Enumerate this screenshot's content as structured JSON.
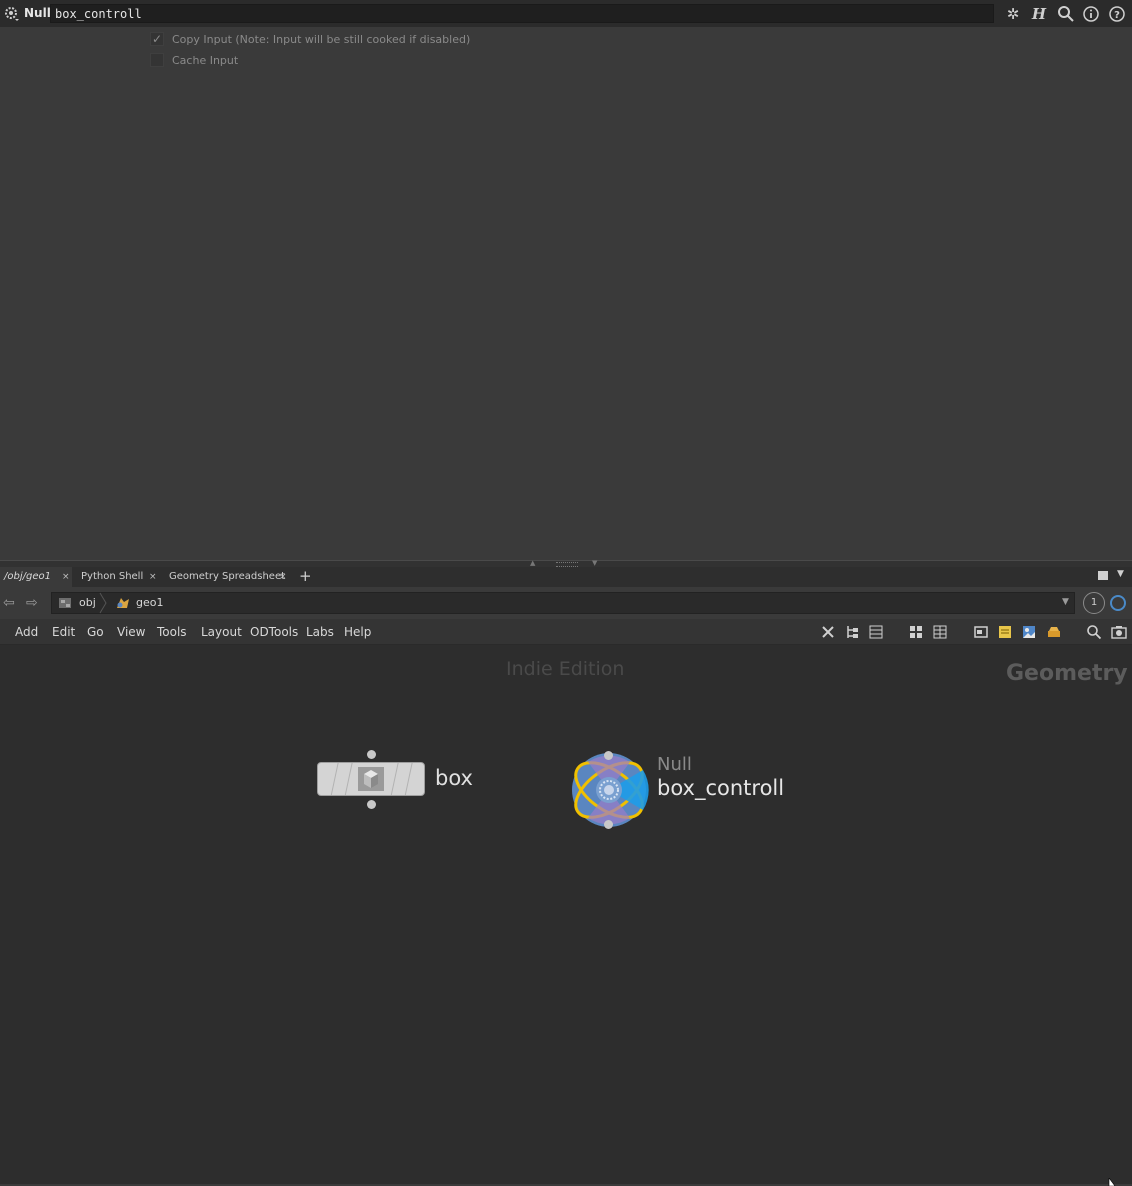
{
  "param_pane": {
    "node_type": "Null",
    "node_name": "box_controll",
    "header_icons": [
      "gear-icon",
      "houdini-h-icon",
      "search-icon",
      "info-icon",
      "help-icon"
    ],
    "params": [
      {
        "label": "Copy Input (Note: Input will be still cooked if disabled)",
        "checked": true
      },
      {
        "label": "Cache Input",
        "checked": false
      }
    ]
  },
  "tabs": [
    {
      "label": "/obj/geo1",
      "active": true
    },
    {
      "label": "Python Shell",
      "active": false
    },
    {
      "label": "Geometry Spreadsheet",
      "active": false
    }
  ],
  "tab_close_glyph": "×",
  "tab_add_glyph": "+",
  "path": {
    "crumbs": [
      "obj",
      "geo1"
    ],
    "pin_label": "1"
  },
  "menu": [
    "Add",
    "Edit",
    "Go",
    "View",
    "Tools",
    "Layout",
    "ODTools",
    "Labs",
    "Help"
  ],
  "network": {
    "watermark": "Indie Edition",
    "context": "Geometry",
    "nodes": [
      {
        "type": "box",
        "name": "box"
      },
      {
        "type": "Null",
        "name": "box_controll",
        "selected": true
      }
    ]
  },
  "colors": {
    "accent_blue": "#4a8ac8",
    "selected_outline": "#f0c000",
    "null_node_blue": "#5a86c0"
  }
}
